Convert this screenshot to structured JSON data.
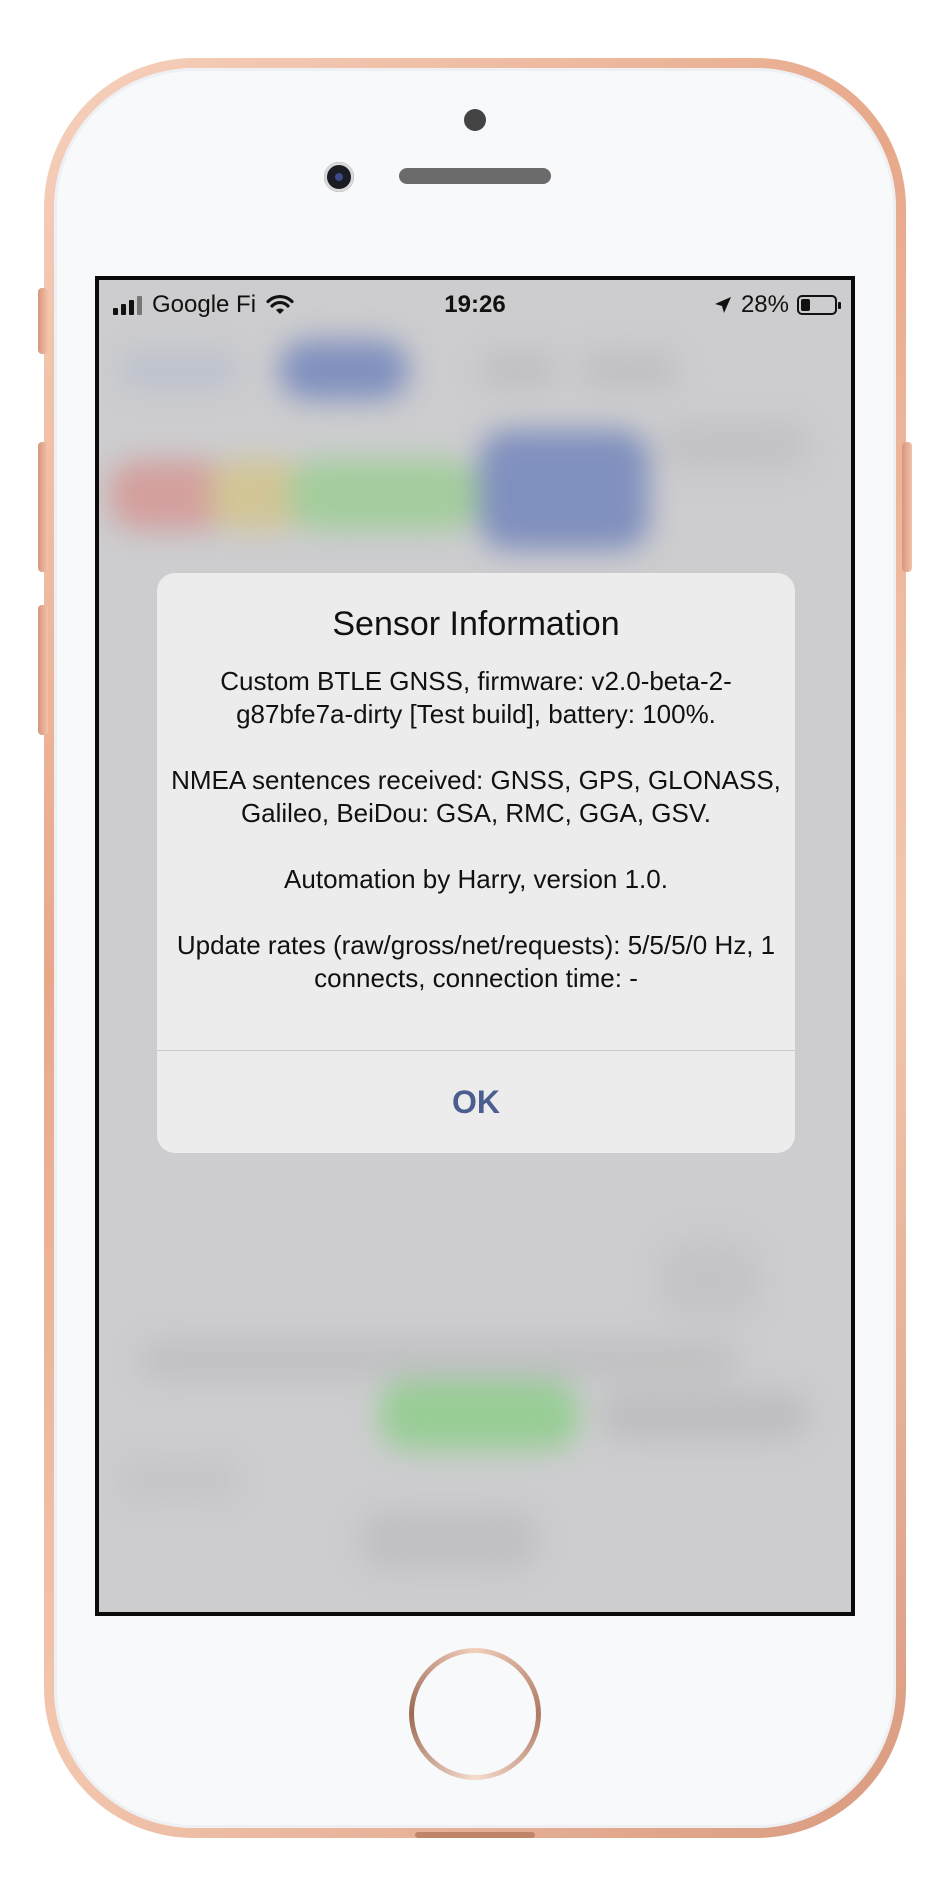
{
  "status_bar": {
    "carrier": "Google Fi",
    "time": "19:26",
    "battery_percent": "28%",
    "battery_level": 0.28,
    "icons": [
      "signal-icon",
      "wifi-icon",
      "location-arrow-icon",
      "battery-icon"
    ]
  },
  "alert": {
    "title": "Sensor Information",
    "paragraphs": [
      "Custom BTLE GNSS, firmware: v2.0-beta-2-g87bfe7a-dirty [Test build], battery: 100%.",
      "NMEA sentences received: GNSS, GPS, GLONASS, Galileo, BeiDou: GSA, RMC, GGA, GSV.",
      "Automation by Harry, version 1.0.",
      "Update rates (raw/gross/net/requests): 5/5/5/0 Hz, 1 connects, connection time: -"
    ],
    "ok_label": "OK",
    "ok_color": "#4a5f8f"
  }
}
